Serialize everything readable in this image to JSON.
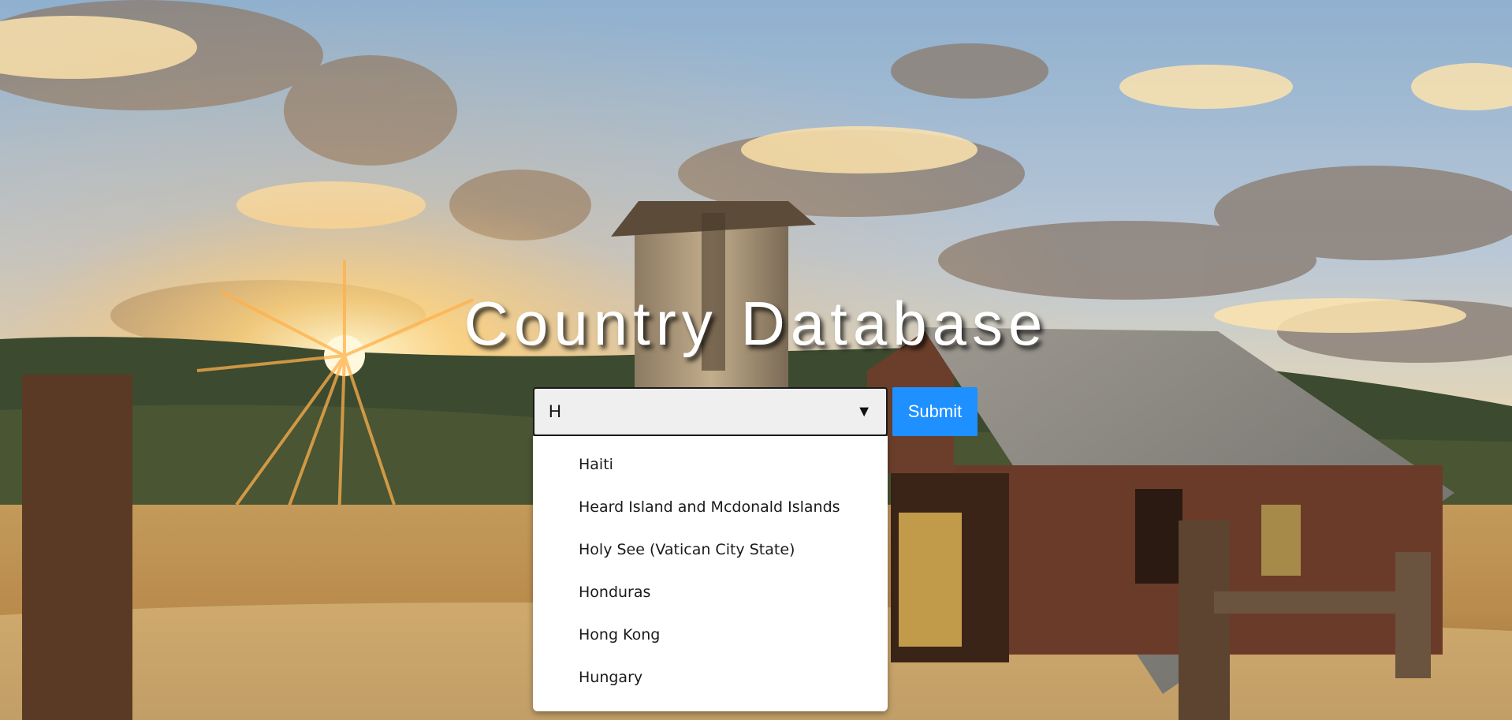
{
  "page": {
    "title": "Country Database"
  },
  "search": {
    "selected_value": "H",
    "submit_label": "Submit"
  },
  "dropdown": {
    "options": [
      "Haiti",
      "Heard Island and Mcdonald Islands",
      "Holy See (Vatican City State)",
      "Honduras",
      "Hong Kong",
      "Hungary"
    ]
  },
  "icons": {
    "select_arrow": "chevron-down-icon"
  },
  "colors": {
    "accent": "#1e90ff",
    "select_background": "#efefef",
    "dropdown_background": "#ffffff",
    "title_text": "#ffffff"
  }
}
